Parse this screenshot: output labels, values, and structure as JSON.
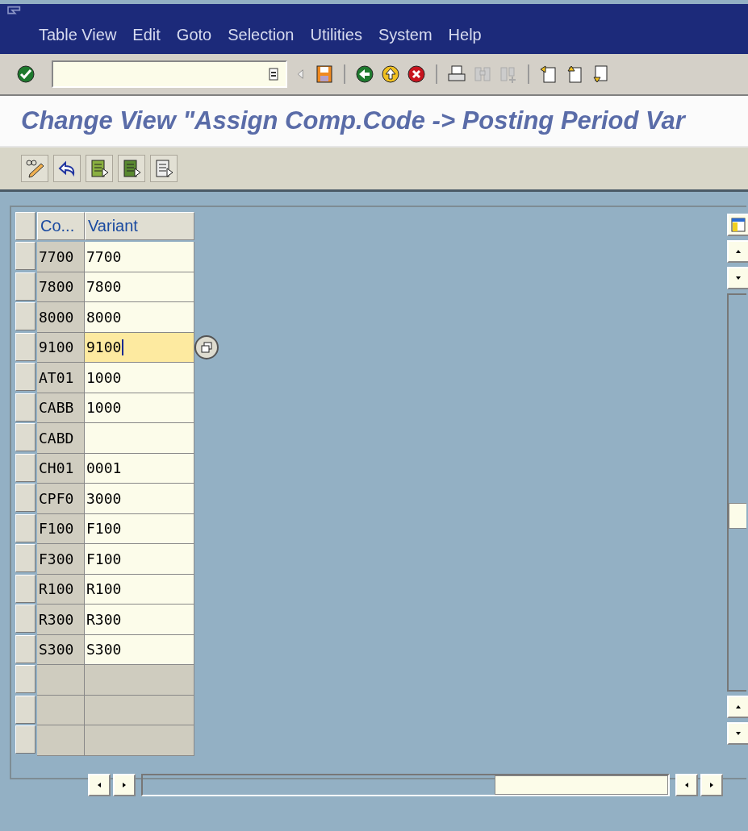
{
  "menu": [
    "Table View",
    "Edit",
    "Goto",
    "Selection",
    "Utilities",
    "System",
    "Help"
  ],
  "title": "Change View \"Assign Comp.Code -> Posting Period Var",
  "table": {
    "columns": [
      "Co...",
      "Variant"
    ],
    "rows": [
      {
        "kind": "data",
        "code": "7700",
        "variant": "7700",
        "focused": false
      },
      {
        "kind": "data",
        "code": "7800",
        "variant": "7800",
        "focused": false
      },
      {
        "kind": "data",
        "code": "8000",
        "variant": "8000",
        "focused": false
      },
      {
        "kind": "data",
        "code": "9100",
        "variant": "9100",
        "focused": true
      },
      {
        "kind": "data",
        "code": "AT01",
        "variant": "1000",
        "focused": false
      },
      {
        "kind": "data",
        "code": "CABB",
        "variant": "1000",
        "focused": false
      },
      {
        "kind": "data",
        "code": "CABD",
        "focused": false
      },
      {
        "kind": "data",
        "code": "CH01",
        "variant": "0001",
        "focused": false
      },
      {
        "kind": "data",
        "code": "CPF0",
        "variant": "3000",
        "focused": false
      },
      {
        "kind": "data",
        "code": "F100",
        "variant": "F100",
        "focused": false
      },
      {
        "kind": "data",
        "code": "F300",
        "variant": "F100",
        "focused": false
      },
      {
        "kind": "data",
        "code": "R100",
        "variant": "R100",
        "focused": false
      },
      {
        "kind": "data",
        "code": "R300",
        "variant": "R300",
        "focused": false
      },
      {
        "kind": "data",
        "code": "S300",
        "variant": "S300",
        "focused": false
      },
      {
        "kind": "empty"
      },
      {
        "kind": "empty"
      },
      {
        "kind": "empty"
      }
    ]
  }
}
